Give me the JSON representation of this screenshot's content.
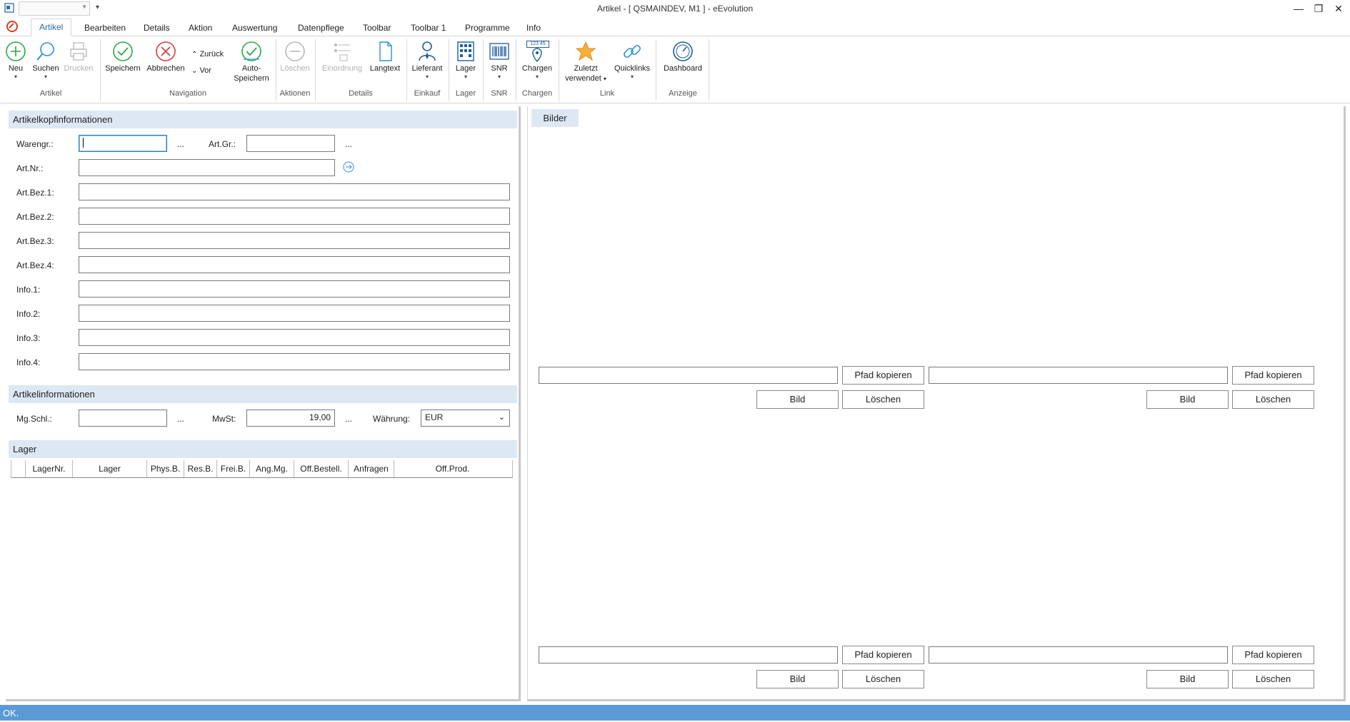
{
  "window": {
    "title": "Artikel - [ QSMAINDEV, M1 ]  -  eEvolution"
  },
  "tabs": [
    "Artikel",
    "Bearbeiten",
    "Details",
    "Aktion",
    "Auswertung",
    "Datenpflege",
    "Toolbar",
    "Toolbar 1",
    "Programme",
    "Info"
  ],
  "ribbon": {
    "neu": "Neu",
    "suchen": "Suchen",
    "drucken": "Drucken",
    "speichern": "Speichern",
    "abbrechen": "Abbrechen",
    "zurueck": "Zurück",
    "vor": "Vor",
    "auto1": "Auto-",
    "auto2": "Speichern",
    "loeschen": "Löschen",
    "einordnung": "Einordnung",
    "langtext": "Langtext",
    "lieferant": "Lieferant",
    "lager": "Lager",
    "snr": "SNR",
    "chargen": "Chargen",
    "chargen_icon_text": "123 45",
    "zuletzt1": "Zuletzt",
    "zuletzt2": "verwendet",
    "quicklinks": "Quicklinks",
    "dashboard": "Dashboard",
    "groups": {
      "artikel": "Artikel",
      "navigation": "Navigation",
      "aktionen": "Aktionen",
      "details": "Details",
      "einkauf": "Einkauf",
      "lager": "Lager",
      "snr": "SNR",
      "chargen": "Chargen",
      "link": "Link",
      "anzeige": "Anzeige"
    }
  },
  "kopf": {
    "title": "Artikelkopfinformationen",
    "warengr": "Warengr.:",
    "artgr": "Art.Gr.:",
    "artnr": "Art.Nr.:",
    "artbez1": "Art.Bez.1:",
    "artbez2": "Art.Bez.2:",
    "artbez3": "Art.Bez.3:",
    "artbez4": "Art.Bez.4:",
    "info1": "Info.1:",
    "info2": "Info.2:",
    "info3": "Info.3:",
    "info4": "Info.4:",
    "dots": "..."
  },
  "artinfo": {
    "title": "Artikelinformationen",
    "mgschl": "Mg.Schl.:",
    "mwst": "MwSt:",
    "mwst_value": "19,00",
    "waehrung": "Währung:",
    "waehrung_value": "EUR",
    "dots": "..."
  },
  "lager": {
    "title": "Lager",
    "columns": [
      "LagerNr.",
      "Lager",
      "Phys.B.",
      "Res.B.",
      "Frei.B.",
      "Ang.Mg.",
      "Off.Bestell.",
      "Anfragen",
      "Off.Prod."
    ]
  },
  "bilder": {
    "title": "Bilder",
    "pfad": "Pfad kopieren",
    "bild": "Bild",
    "loeschen": "Löschen"
  },
  "status": {
    "text": "OK."
  }
}
